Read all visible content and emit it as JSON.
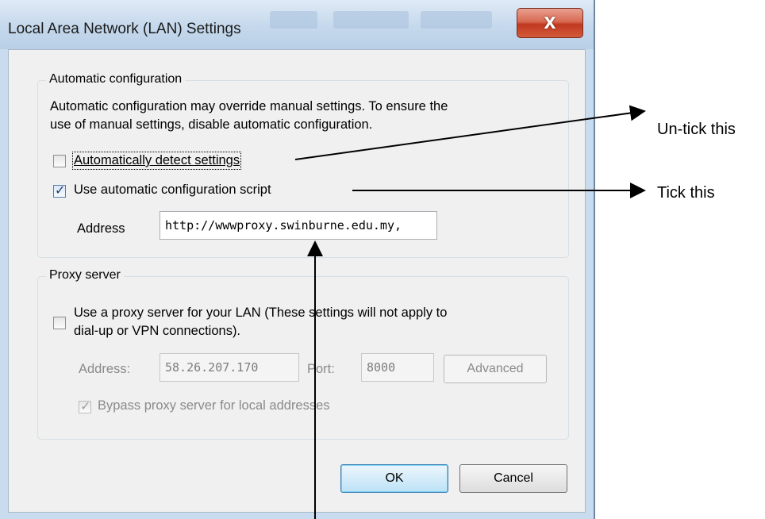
{
  "window": {
    "title": "Local Area Network (LAN) Settings",
    "close_glyph": "X"
  },
  "auto_config": {
    "legend": "Automatic configuration",
    "description_line1": "Automatic configuration may override manual settings.  To ensure the",
    "description_line2": "use of manual settings, disable automatic configuration.",
    "detect_settings": {
      "label": "Automatically detect settings",
      "checked": false
    },
    "use_script": {
      "label": "Use automatic configuration script",
      "checked": true
    },
    "address_label": "Address",
    "address_value": "http://wwwproxy.swinburne.edu.my,"
  },
  "proxy": {
    "legend": "Proxy server",
    "use_proxy": {
      "label_line1": "Use a proxy server for your LAN (These settings will not apply to",
      "label_line2": "dial-up or VPN connections).",
      "checked": false
    },
    "address_label": "Address:",
    "address_value": "58.26.207.170",
    "port_label": "Port:",
    "port_value": "8000",
    "advanced_label": "Advanced",
    "bypass": {
      "label": "Bypass proxy server for local addresses",
      "checked": true,
      "disabled": true
    }
  },
  "buttons": {
    "ok": "OK",
    "cancel": "Cancel"
  },
  "annotations": {
    "untick": "Un-tick this",
    "tick": "Tick this"
  }
}
